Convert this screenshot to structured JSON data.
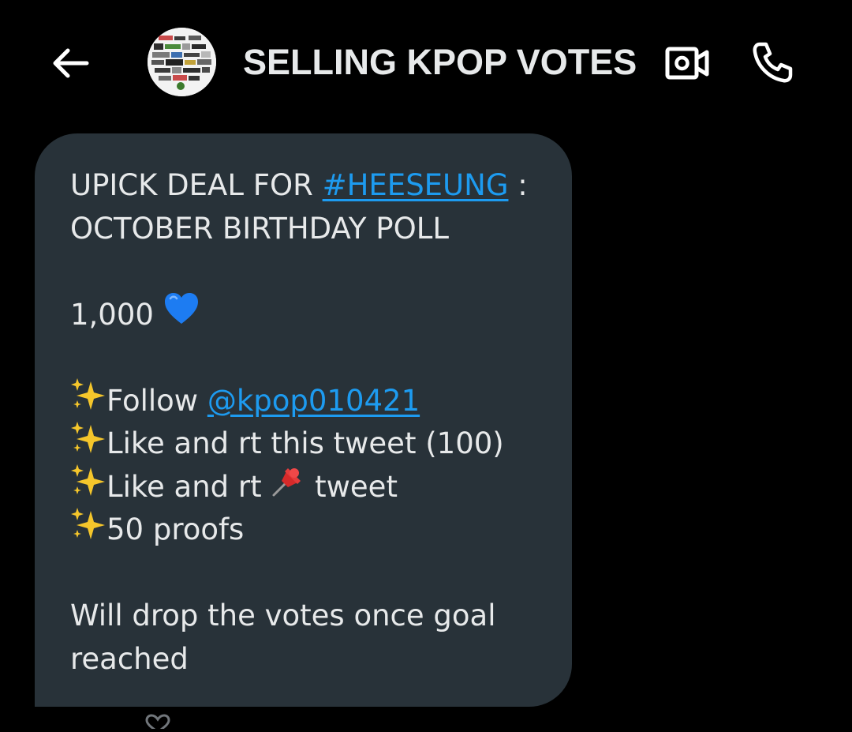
{
  "header": {
    "title": "SELLING KPOP VOTES",
    "back_icon": "arrow-left-icon",
    "video_icon": "video-call-icon",
    "call_icon": "phone-icon"
  },
  "message": {
    "line1_prefix": "UPICK DEAL FOR ",
    "line1_hashtag": "#HEESEUNG",
    "line1_suffix": " :",
    "line2": "OCTOBER BIRTHDAY POLL",
    "price": "1,000",
    "price_emoji": "blue-heart-icon",
    "req1_prefix": "Follow ",
    "req1_mention": "@kpop010421",
    "req2": "Like and rt this tweet (100)",
    "req3_prefix": "Like and rt ",
    "req3_emoji": "pushpin-icon",
    "req3_suffix": " tweet",
    "req4": "50 proofs",
    "bullet_icon": "sparkles-icon",
    "closing_line1": "Will drop the votes once goal",
    "closing_line2": "reached"
  },
  "colors": {
    "background": "#000000",
    "bubble": "#283239",
    "text": "#e7e9ea",
    "link": "#1d9bf0",
    "heart": "#1d7cf2",
    "sparkle": "#f5c62b"
  }
}
